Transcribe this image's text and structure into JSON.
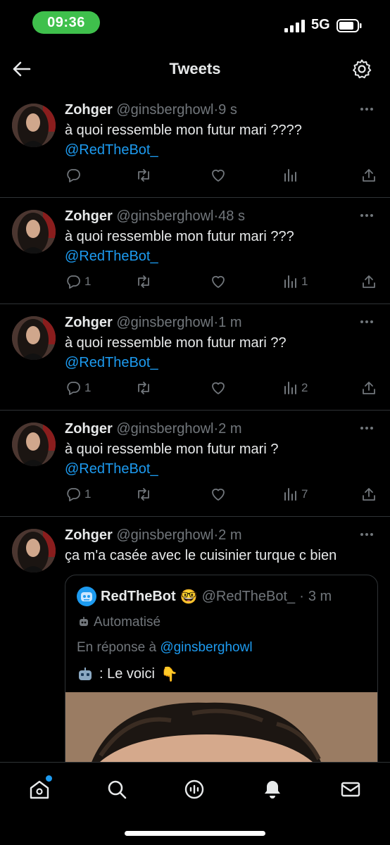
{
  "status_bar": {
    "time": "09:36",
    "network": "5G"
  },
  "header": {
    "title": "Tweets"
  },
  "tweets": [
    {
      "name": "Zohger",
      "handle": "@ginsberghowl",
      "time": "9 s",
      "text": "à quoi ressemble mon futur mari ????",
      "mention": "@RedTheBot_",
      "replies": "",
      "retweets": "",
      "likes": "",
      "views": ""
    },
    {
      "name": "Zohger",
      "handle": "@ginsberghowl",
      "time": "48 s",
      "text": "à quoi ressemble mon futur mari ???",
      "mention": "@RedTheBot_",
      "replies": "1",
      "retweets": "",
      "likes": "",
      "views": "1"
    },
    {
      "name": "Zohger",
      "handle": "@ginsberghowl",
      "time": "1 m",
      "text": "à quoi ressemble mon futur mari ??",
      "mention": "@RedTheBot_",
      "replies": "1",
      "retweets": "",
      "likes": "",
      "views": "2"
    },
    {
      "name": "Zohger",
      "handle": "@ginsberghowl",
      "time": "2 m",
      "text": "à quoi ressemble mon futur mari ?",
      "mention": "@RedTheBot_",
      "replies": "1",
      "retweets": "",
      "likes": "",
      "views": "7"
    },
    {
      "name": "Zohger",
      "handle": "@ginsberghowl",
      "time": "2 m",
      "text": "ça m'a casée avec le cuisinier turque c bien"
    }
  ],
  "quote": {
    "name": "RedTheBot",
    "name_emoji": "🤓",
    "handle": "@RedTheBot_",
    "time": "3 m",
    "automated_label": "Automatisé",
    "reply_prefix": "En réponse à",
    "reply_to": "@ginsberghowl",
    "text": ": Le voici",
    "text_emoji_after": "👇"
  },
  "separator": "·",
  "colors": {
    "accent": "#1d9bf0",
    "muted": "#71767b",
    "status_pill": "#3fc04c",
    "background": "#000000"
  },
  "icons": [
    "back-arrow-icon",
    "settings-icon",
    "reply-icon",
    "retweet-icon",
    "like-icon",
    "views-icon",
    "share-icon",
    "home-icon",
    "search-icon",
    "spaces-icon",
    "notifications-icon",
    "messages-icon"
  ]
}
